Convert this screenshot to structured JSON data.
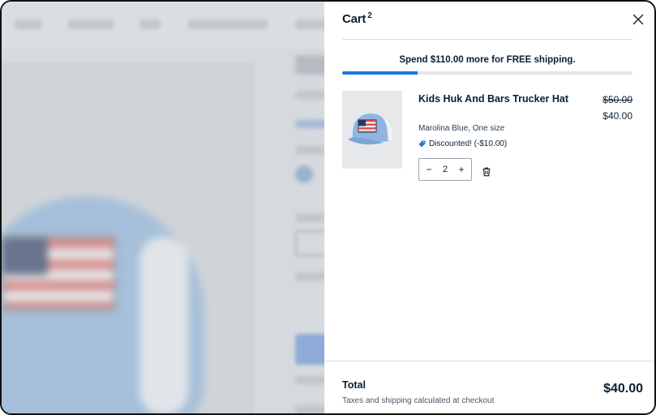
{
  "background_page": {
    "overlay_color": "#d2d6db"
  },
  "cart": {
    "title": "Cart",
    "count": "2",
    "close_icon": "close-icon",
    "shipping_message": "Spend $110.00 more for FREE shipping.",
    "shipping_progress": 0.26,
    "accent_color": "#1976e8",
    "items": [
      {
        "name": "Kids Huk And Bars Trucker Hat",
        "variant": "Marolina Blue, One size",
        "discount_icon": "tag-icon",
        "discount_text": "Discounted! (-$10.00)",
        "original_price": "$50.00",
        "price": "$40.00",
        "quantity": "2",
        "decrement_label": "−",
        "increment_label": "+",
        "remove_icon": "trash-icon"
      }
    ],
    "footer": {
      "total_label": "Total",
      "total_amount": "$40.00",
      "note": "Taxes and shipping calculated at checkout"
    }
  }
}
